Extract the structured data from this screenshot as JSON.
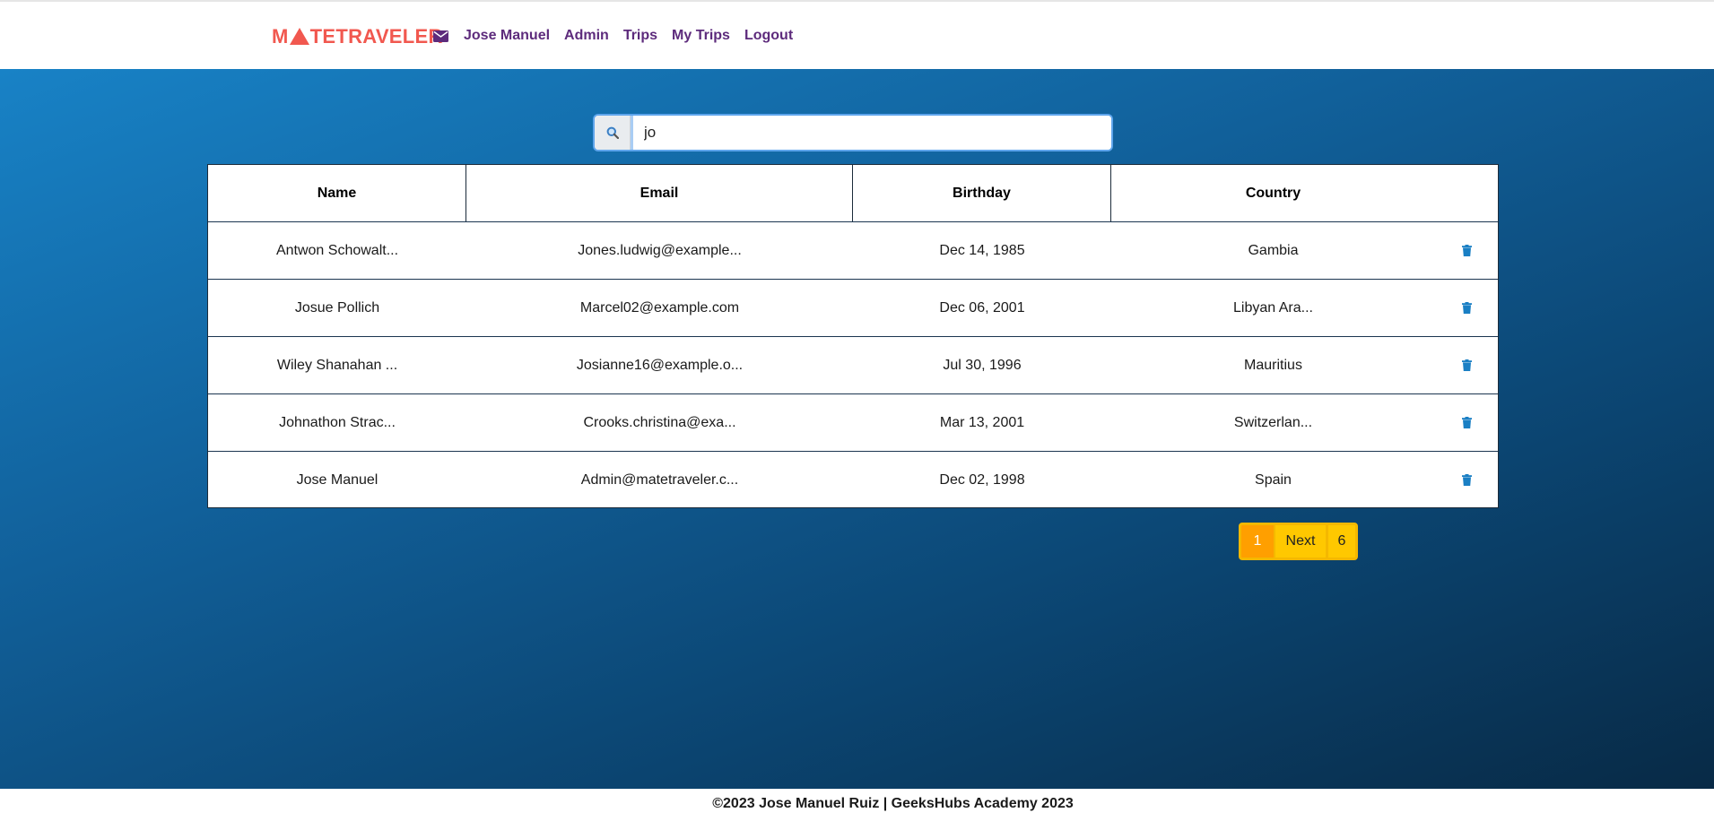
{
  "header": {
    "brand_left": "M",
    "brand_right": "TETRAVELER",
    "nav": [
      "Jose Manuel",
      "Admin",
      "Trips",
      "My Trips",
      "Logout"
    ]
  },
  "search": {
    "value": "jo"
  },
  "table": {
    "columns": [
      "Name",
      "Email",
      "Birthday",
      "Country"
    ],
    "rows": [
      {
        "name": "Antwon Schowalt...",
        "email": "Jones.ludwig@example...",
        "birthday": "Dec 14, 1985",
        "country": "Gambia"
      },
      {
        "name": "Josue Pollich",
        "email": "Marcel02@example.com",
        "birthday": "Dec 06, 2001",
        "country": "Libyan Ara..."
      },
      {
        "name": "Wiley Shanahan ...",
        "email": "Josianne16@example.o...",
        "birthday": "Jul 30, 1996",
        "country": "Mauritius"
      },
      {
        "name": "Johnathon Strac...",
        "email": "Crooks.christina@exa...",
        "birthday": "Mar 13, 2001",
        "country": "Switzerlan..."
      },
      {
        "name": "Jose Manuel",
        "email": "Admin@matetraveler.c...",
        "birthday": "Dec 02, 1998",
        "country": "Spain"
      }
    ]
  },
  "pagination": {
    "current": "1",
    "next": "Next",
    "last": "6"
  },
  "footer": {
    "text": "©2023 Jose Manuel Ruiz | GeeksHubs Academy 2023"
  },
  "colors": {
    "brand": "#f1584f",
    "nav": "#5d2b7c",
    "trash": "#1a7fc4",
    "pager_active": "#ff9f00",
    "pager": "#ffc800"
  },
  "icons": {
    "mail": "envelope-icon",
    "search": "search-icon",
    "delete": "trash-icon"
  }
}
